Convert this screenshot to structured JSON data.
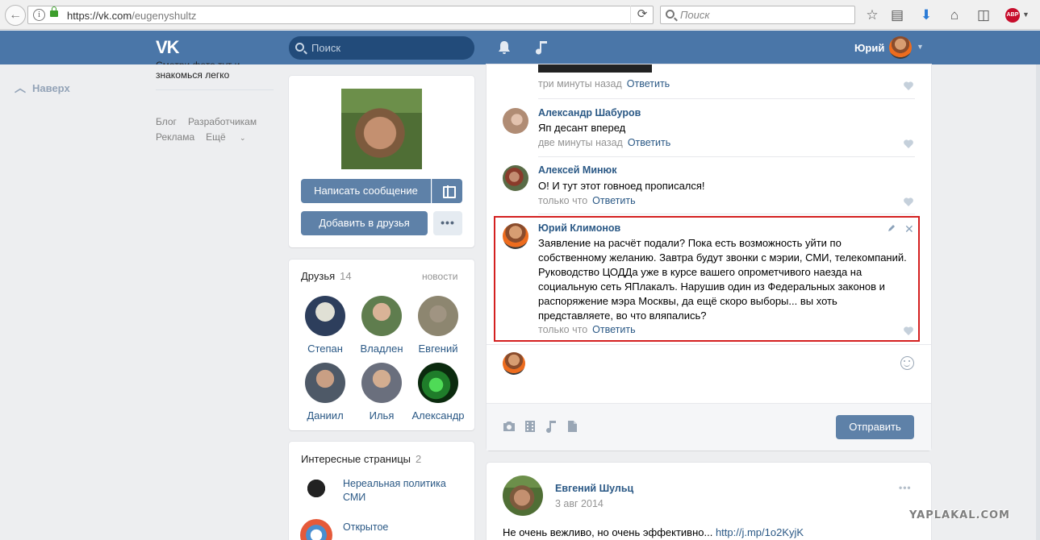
{
  "browser": {
    "url_host": "https://vk.com",
    "url_path": "/eugenyshultz",
    "search_placeholder": "Поиск",
    "abp_label": "ABP"
  },
  "header": {
    "logo": "VK",
    "search_placeholder": "Поиск",
    "user_name": "Юрий"
  },
  "left_nav": {
    "up_label": "Наверх",
    "promo_cut": "Смотри фото тут и",
    "promo_line": "знакомься легко",
    "footer_links": [
      "Блог",
      "Разработчикам",
      "Реклама",
      "Ещё"
    ]
  },
  "profile": {
    "write_message": "Написать сообщение",
    "add_friend": "Добавить в друзья",
    "more": "•••"
  },
  "friends": {
    "title": "Друзья",
    "count": "14",
    "news_link": "новости",
    "items": [
      {
        "name": "Степан",
        "color": "#2d3e5c"
      },
      {
        "name": "Владлен",
        "color": "#5f7d4e"
      },
      {
        "name": "Евгений",
        "color": "#8d8670"
      },
      {
        "name": "Даниил",
        "color": "#4e5967"
      },
      {
        "name": "Илья",
        "color": "#6a6f7d"
      },
      {
        "name": "Александр",
        "color": "#1f7d2a"
      }
    ]
  },
  "pages": {
    "title": "Интересные страницы",
    "count": "2",
    "items": [
      {
        "name": "Нереальная политика СМИ"
      },
      {
        "name": "Открытое"
      }
    ]
  },
  "comments": [
    {
      "author": "",
      "text": "",
      "time": "три минуты назад",
      "reply": "Ответить"
    },
    {
      "author": "Александр Шабуров",
      "text": "Яп десант вперед",
      "time": "две минуты назад",
      "reply": "Ответить"
    },
    {
      "author": "Алексей Минюк",
      "text": "О! И тут этот говноед прописался!",
      "time": "только что",
      "reply": "Ответить"
    },
    {
      "author": "Юрий Климонов",
      "text_lines": [
        "Заявление на расчёт подали? Пока есть возможность уйти по",
        "собственному желанию. Завтра будут звонки с мэрии, СМИ, телекомпаний.",
        "Руководство ЦОДДа уже в курсе вашего опрометчивого наезда на",
        "социальную сеть ЯПлакалъ. Нарушив один из Федеральных законов и",
        "распоряжение мэра Москвы, да ещё скоро выборы... вы хоть",
        "представляете, во что вляпались?"
      ],
      "time": "только что",
      "reply": "Ответить"
    }
  ],
  "reply_box": {
    "send": "Отправить"
  },
  "post": {
    "author": "Евгений Шульц",
    "date": "3 авг 2014",
    "text": "Не очень вежливо, но очень эффективно... ",
    "link": "http://j.mp/1o2KyjK",
    "more": "•••"
  },
  "watermark": "YAPLAKAL.COM",
  "colors": {
    "vk_blue": "#4a76a8",
    "link": "#2a5885",
    "highlight": "#d42020"
  }
}
